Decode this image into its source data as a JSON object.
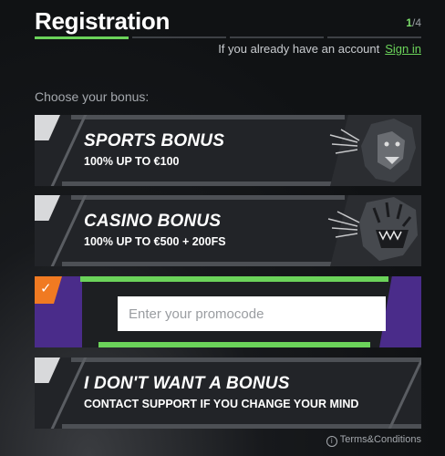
{
  "header": {
    "title": "Registration",
    "step_current": "1",
    "step_total": "/4",
    "account_prompt": "If you already have an account",
    "signin_label": "Sign in"
  },
  "choose_label": "Choose your bonus:",
  "bonuses": [
    {
      "title": "SPORTS BONUS",
      "subtitle": "100% UP TO €100",
      "image": "lion-icon"
    },
    {
      "title": "CASINO BONUS",
      "subtitle": "100% UP TO €500 + 200FS",
      "image": "tiger-icon"
    }
  ],
  "promo": {
    "placeholder": "Enter your promocode",
    "value": "",
    "selected": true
  },
  "no_bonus": {
    "title": "I DON'T WANT A BONUS",
    "subtitle": "CONTACT SUPPORT IF YOU CHANGE YOUR MIND"
  },
  "footer": {
    "terms_label": "Terms&Conditions"
  },
  "colors": {
    "accent": "#6bd35a",
    "check": "#f07a22",
    "promo_side": "#4a2c8a"
  }
}
